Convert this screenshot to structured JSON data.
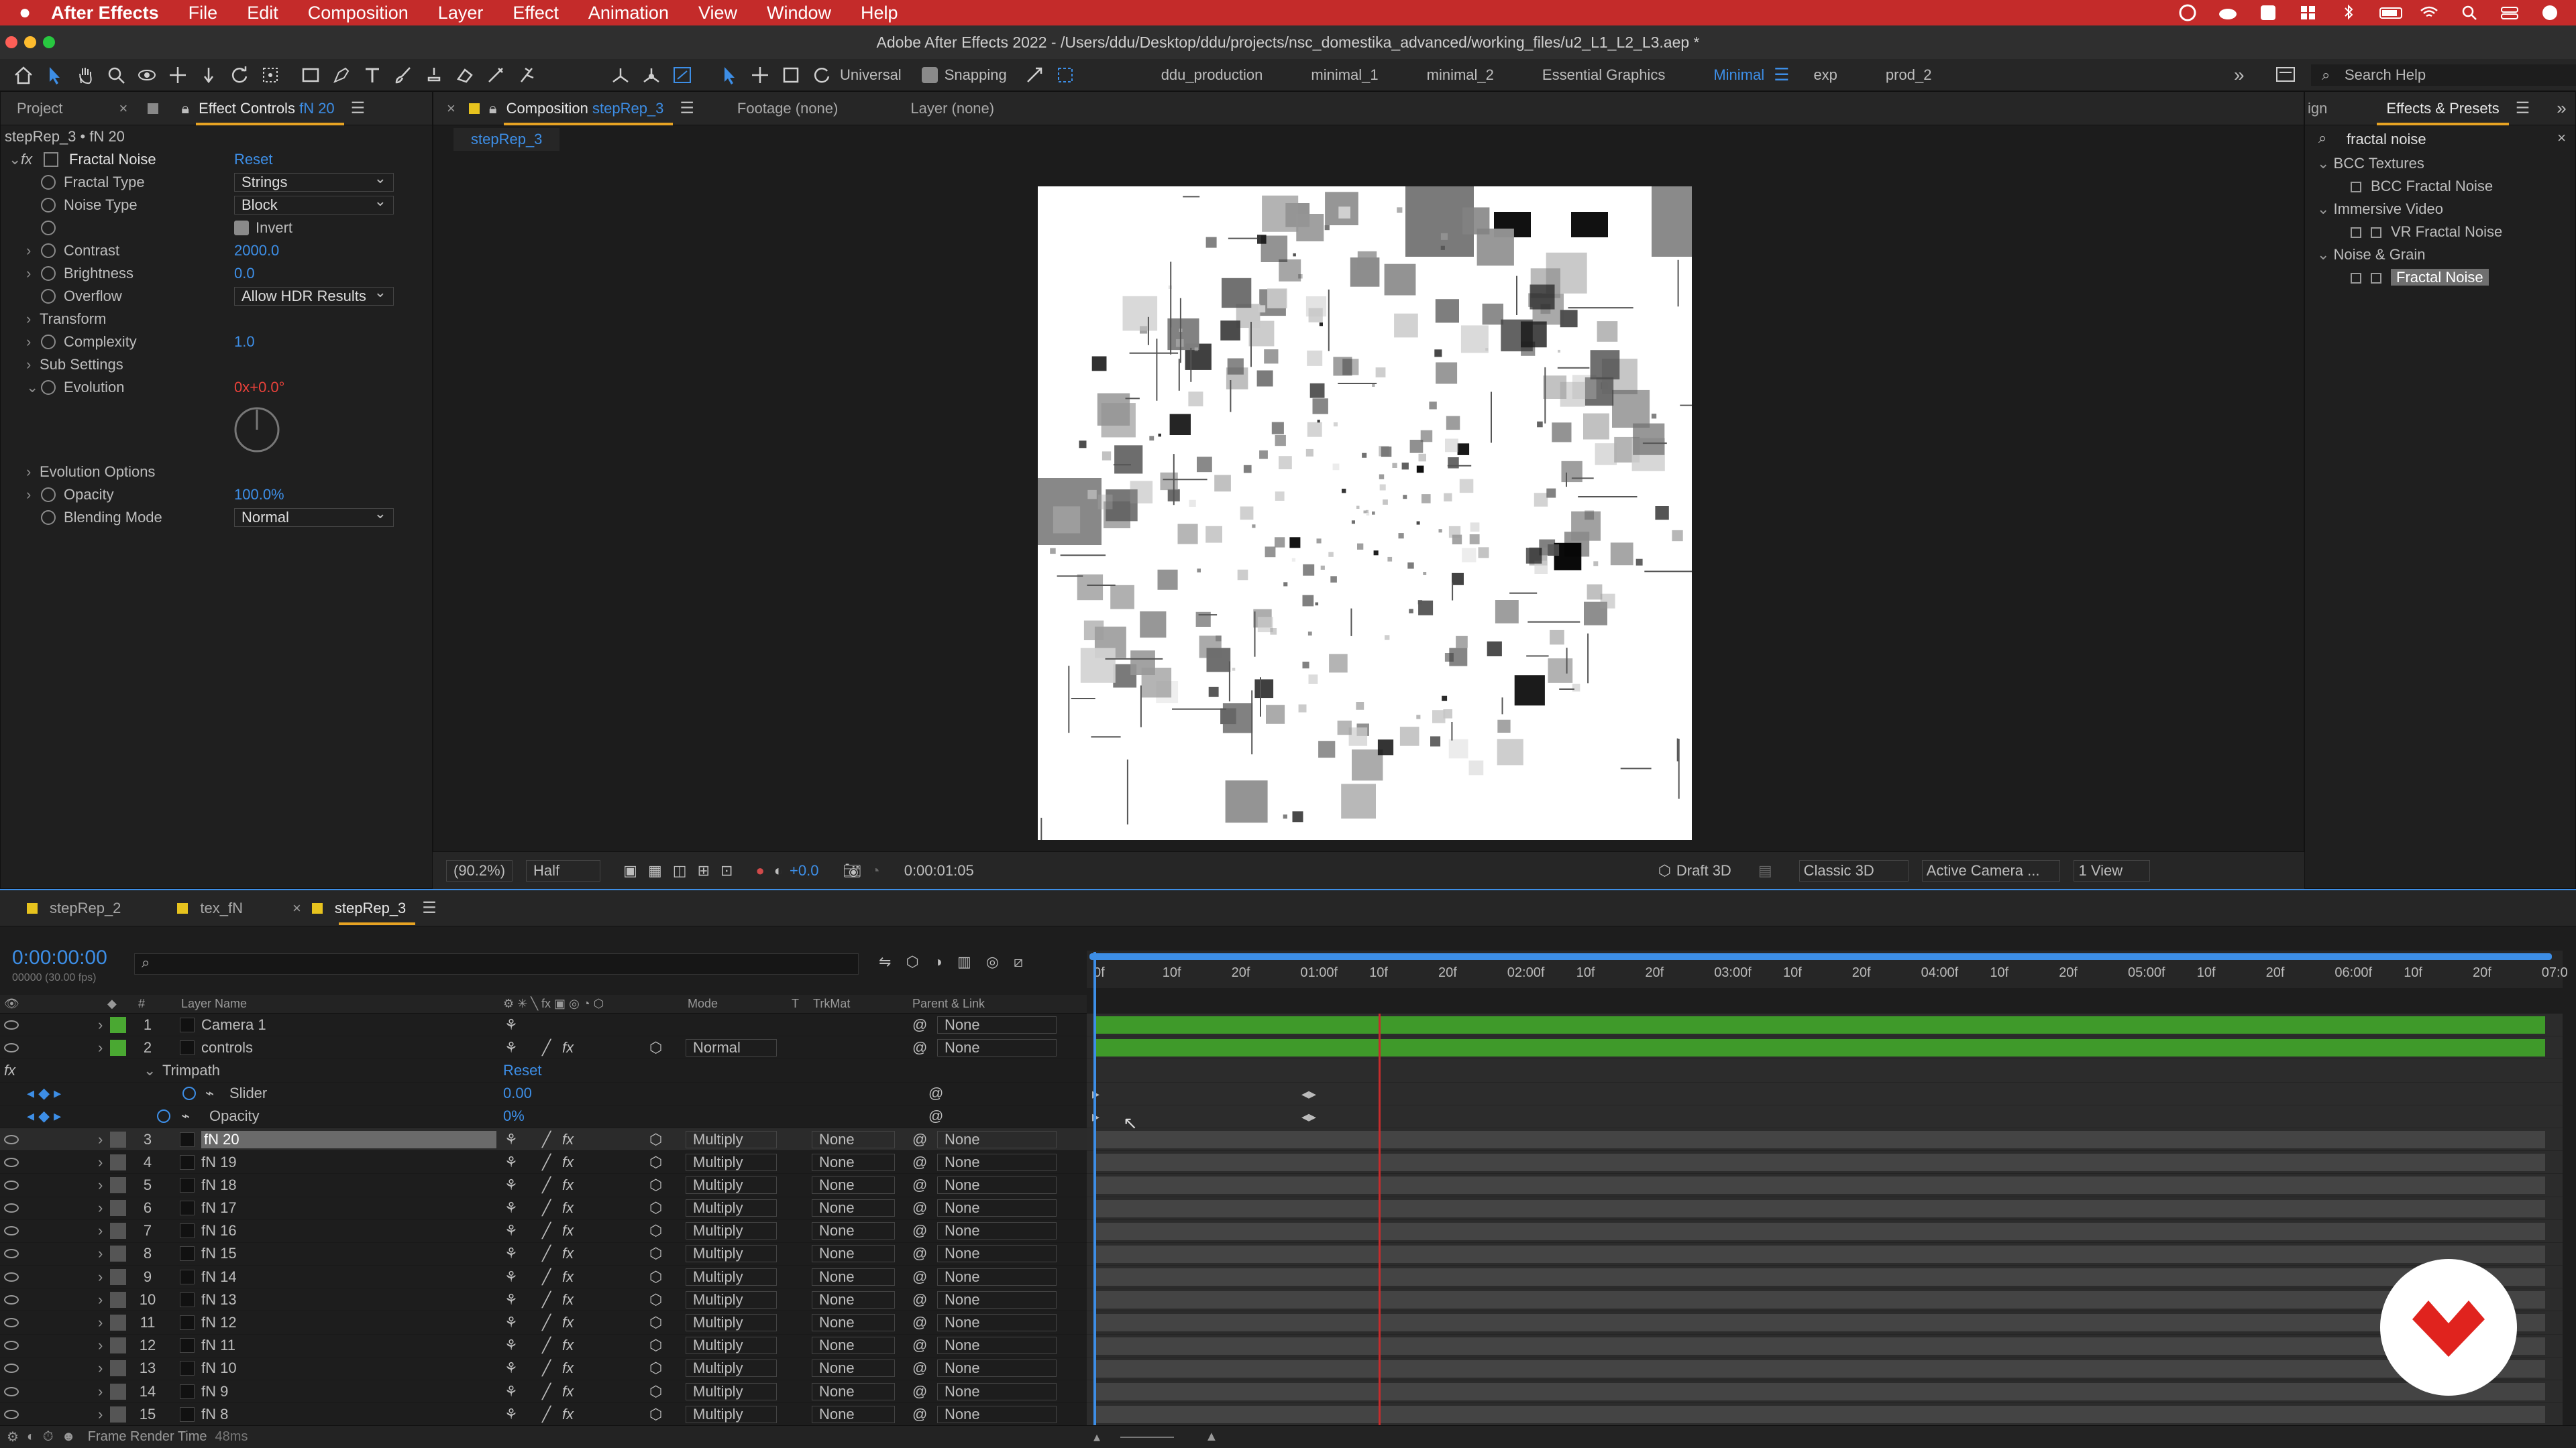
{
  "menubar": {
    "app_name": "After Effects",
    "items": [
      "File",
      "Edit",
      "Composition",
      "Layer",
      "Effect",
      "Animation",
      "View",
      "Window",
      "Help"
    ]
  },
  "titlebar": {
    "title": "Adobe After Effects 2022 - /Users/ddu/Desktop/ddu/projects/nsc_domestika_advanced/working_files/u2_L1_L2_L3.aep *"
  },
  "toolbar": {
    "universal_label": "Universal",
    "snapping_label": "Snapping",
    "workspaces": [
      "ddu_production",
      "minimal_1",
      "minimal_2",
      "Essential Graphics",
      "Minimal",
      "exp",
      "prod_2"
    ],
    "active_workspace": "Minimal",
    "search_placeholder": "Search Help"
  },
  "effect_controls": {
    "tab_project": "Project",
    "tab_label": "Effect Controls",
    "tab_layer": "fN 20",
    "breadcrumb": "stepRep_3 • fN 20",
    "effect_name": "Fractal Noise",
    "reset_label": "Reset",
    "params": [
      {
        "name": "Fractal Type",
        "value": "Strings",
        "kind": "dropdown"
      },
      {
        "name": "Noise Type",
        "value": "Block",
        "kind": "dropdown"
      },
      {
        "name": "",
        "value": "Invert",
        "kind": "checkbox"
      },
      {
        "name": "Contrast",
        "value": "2000.0",
        "kind": "number"
      },
      {
        "name": "Brightness",
        "value": "0.0",
        "kind": "number"
      },
      {
        "name": "Overflow",
        "value": "Allow HDR Results",
        "kind": "dropdown"
      },
      {
        "name": "Transform",
        "value": "",
        "kind": "group"
      },
      {
        "name": "Complexity",
        "value": "1.0",
        "kind": "number"
      },
      {
        "name": "Sub Settings",
        "value": "",
        "kind": "group"
      },
      {
        "name": "Evolution",
        "value": "0x+0.0°",
        "kind": "angle"
      },
      {
        "name": "Evolution Options",
        "value": "",
        "kind": "group"
      },
      {
        "name": "Opacity",
        "value": "100.0%",
        "kind": "number"
      },
      {
        "name": "Blending Mode",
        "value": "Normal",
        "kind": "dropdown"
      }
    ]
  },
  "composition": {
    "tab_label": "Composition",
    "tab_comp": "stepRep_3",
    "footage_tab": "Footage (none)",
    "layer_tab": "Layer (none)",
    "subtab": "stepRep_3",
    "zoom": "(90.2%)",
    "resolution": "Half",
    "exposure": "+0.0",
    "timecode": "0:00:01:05",
    "draft3d": "Draft 3D",
    "renderer": "Classic 3D",
    "camera": "Active Camera ...",
    "views": "1 View"
  },
  "effects_presets": {
    "tab_cut": "ign",
    "tab_label": "Effects & Presets",
    "search_value": "fractal noise",
    "groups": [
      {
        "name": "BCC Textures",
        "items": [
          "BCC Fractal Noise"
        ]
      },
      {
        "name": "Immersive Video",
        "items": [
          "VR Fractal Noise"
        ]
      },
      {
        "name": "Noise & Grain",
        "items": [
          "Fractal Noise"
        ]
      }
    ],
    "selected": "Fractal Noise"
  },
  "timeline": {
    "tabs": [
      "stepRep_2",
      "tex_fN",
      "stepRep_3"
    ],
    "active_tab": "stepRep_3",
    "timecode": "0:00:00:00",
    "fps": "00000 (30.00 fps)",
    "columns": {
      "layer_name": "Layer Name",
      "mode": "Mode",
      "t": "T",
      "trkmat": "TrkMat",
      "parent": "Parent & Link"
    },
    "ruler": [
      "0f",
      "10f",
      "20f",
      "01:00f",
      "10f",
      "20f",
      "02:00f",
      "10f",
      "20f",
      "03:00f",
      "10f",
      "20f",
      "04:00f",
      "10f",
      "20f",
      "05:00f",
      "10f",
      "20f",
      "06:00f",
      "10f",
      "20f",
      "07:0"
    ],
    "layers": [
      {
        "num": "1",
        "name": "Camera 1",
        "mode": "",
        "trk": "",
        "parent": "None",
        "color": "#4aa832"
      },
      {
        "num": "2",
        "name": "controls",
        "mode": "Normal",
        "trk": "",
        "parent": "None",
        "color": "#4aa832"
      },
      {
        "num": "3",
        "name": "fN 20",
        "mode": "Multiply",
        "trk": "None",
        "parent": "None",
        "color": "#555555"
      },
      {
        "num": "4",
        "name": "fN 19",
        "mode": "Multiply",
        "trk": "None",
        "parent": "None",
        "color": "#555555"
      },
      {
        "num": "5",
        "name": "fN 18",
        "mode": "Multiply",
        "trk": "None",
        "parent": "None",
        "color": "#555555"
      },
      {
        "num": "6",
        "name": "fN 17",
        "mode": "Multiply",
        "trk": "None",
        "parent": "None",
        "color": "#555555"
      },
      {
        "num": "7",
        "name": "fN 16",
        "mode": "Multiply",
        "trk": "None",
        "parent": "None",
        "color": "#555555"
      },
      {
        "num": "8",
        "name": "fN 15",
        "mode": "Multiply",
        "trk": "None",
        "parent": "None",
        "color": "#555555"
      },
      {
        "num": "9",
        "name": "fN 14",
        "mode": "Multiply",
        "trk": "None",
        "parent": "None",
        "color": "#555555"
      },
      {
        "num": "10",
        "name": "fN 13",
        "mode": "Multiply",
        "trk": "None",
        "parent": "None",
        "color": "#555555"
      },
      {
        "num": "11",
        "name": "fN 12",
        "mode": "Multiply",
        "trk": "None",
        "parent": "None",
        "color": "#555555"
      },
      {
        "num": "12",
        "name": "fN 11",
        "mode": "Multiply",
        "trk": "None",
        "parent": "None",
        "color": "#555555"
      },
      {
        "num": "13",
        "name": "fN 10",
        "mode": "Multiply",
        "trk": "None",
        "parent": "None",
        "color": "#555555"
      },
      {
        "num": "14",
        "name": "fN 9",
        "mode": "Multiply",
        "trk": "None",
        "parent": "None",
        "color": "#555555"
      },
      {
        "num": "15",
        "name": "fN 8",
        "mode": "Multiply",
        "trk": "None",
        "parent": "None",
        "color": "#555555"
      }
    ],
    "trimpath": {
      "name": "Trimpath",
      "reset": "Reset",
      "slider_label": "Slider",
      "slider_value": "0.00",
      "opacity_label": "Opacity",
      "opacity_value": "0%"
    },
    "footer": {
      "label": "Frame Render Time",
      "value": "48ms"
    }
  },
  "colors": {
    "accent_blue": "#3d8ee6",
    "menubar_red": "#c42b2a",
    "layer_green": "#4aa832",
    "playhead_red": "#c62c2c"
  }
}
